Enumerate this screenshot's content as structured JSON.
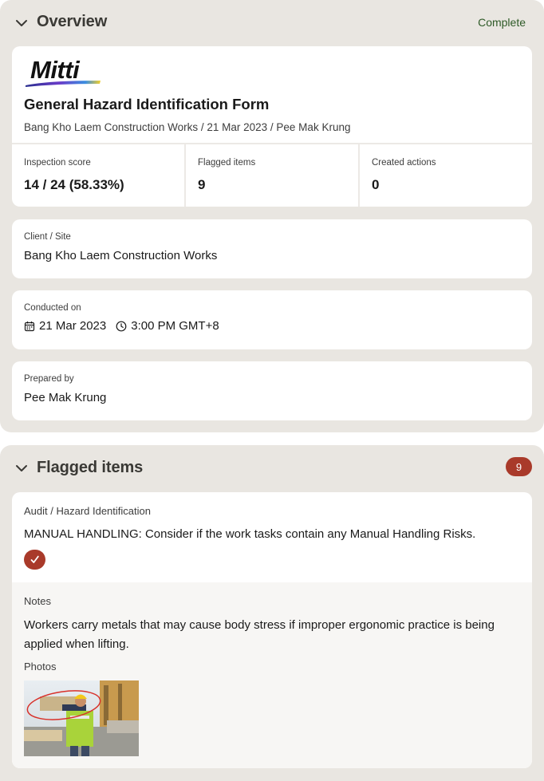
{
  "overview": {
    "title": "Overview",
    "status": "Complete",
    "logo_text": "Mitti",
    "form_title": "General Hazard Identification Form",
    "subtitle": "Bang Kho Laem Construction Works / 21 Mar 2023 / Pee Mak Krung",
    "stats": [
      {
        "label": "Inspection score",
        "value": "14 / 24 (58.33%)"
      },
      {
        "label": "Flagged items",
        "value": "9"
      },
      {
        "label": "Created actions",
        "value": "0"
      }
    ],
    "client_site": {
      "label": "Client / Site",
      "value": "Bang Kho Laem Construction Works"
    },
    "conducted_on": {
      "label": "Conducted on",
      "date": "21 Mar 2023",
      "time": "3:00 PM GMT+8"
    },
    "prepared_by": {
      "label": "Prepared by",
      "value": "Pee Mak Krung"
    }
  },
  "flagged": {
    "title": "Flagged items",
    "count": "9",
    "item": {
      "path": "Audit / Hazard Identification",
      "question": "MANUAL HANDLING: Consider if the work tasks contain any Manual Handling Risks.",
      "answer_icon": "check-icon",
      "notes_label": "Notes",
      "notes": "Workers carry metals that may cause body stress if improper ergonomic practice is being applied when lifting.",
      "photos_label": "Photos"
    }
  },
  "colors": {
    "section_bg": "#e9e6e1",
    "card_bg": "#ffffff",
    "status_green": "#2e5a27",
    "flag_red": "#a93a2a",
    "notes_bg": "#f7f6f4"
  }
}
